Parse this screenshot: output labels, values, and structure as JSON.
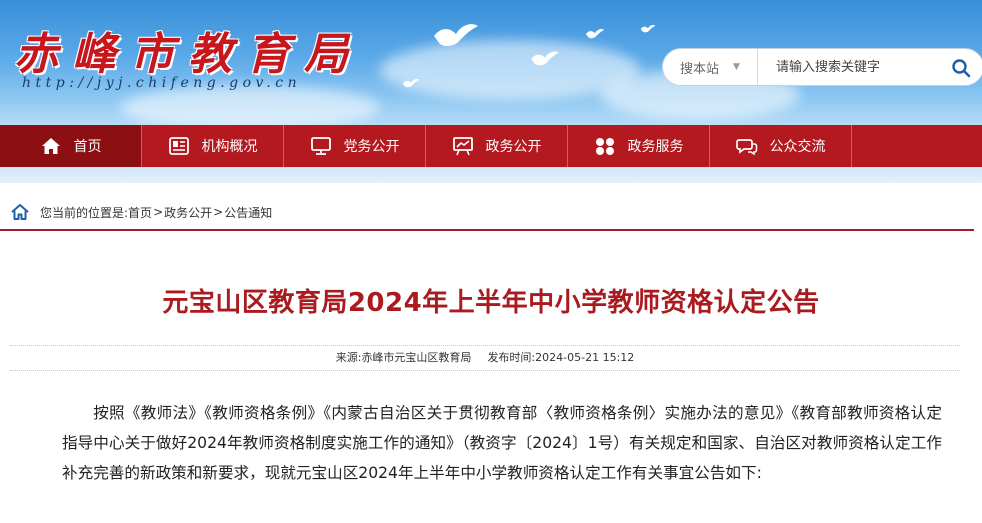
{
  "header": {
    "site_title": "赤峰市教育局",
    "site_url": "http://jyj.chifeng.gov.cn",
    "search": {
      "scope_label": "搜本站",
      "placeholder": "请输入搜索关键字"
    }
  },
  "nav": {
    "items": [
      {
        "label": "首页",
        "icon": "home-icon",
        "active": true
      },
      {
        "label": "机构概况",
        "icon": "info-card-icon",
        "active": false
      },
      {
        "label": "党务公开",
        "icon": "monitor-icon",
        "active": false
      },
      {
        "label": "政务公开",
        "icon": "presentation-board-icon",
        "active": false
      },
      {
        "label": "政务服务",
        "icon": "grid-dots-icon",
        "active": false
      },
      {
        "label": "公众交流",
        "icon": "chat-bubbles-icon",
        "active": false
      }
    ]
  },
  "breadcrumb": {
    "prefix": "您当前的位置是:",
    "items": [
      "首页",
      "政务公开",
      "公告通知"
    ],
    "separator": ">"
  },
  "article": {
    "title": "元宝山区教育局2024年上半年中小学教师资格认定公告",
    "source_label": "来源:",
    "source": "赤峰市元宝山区教育局",
    "date_label": "发布时间:",
    "date": "2024-05-21 15:12",
    "body": "按照《教师法》《教师资格条例》《内蒙古自治区关于贯彻教育部〈教师资格条例〉实施办法的意见》《教育部教师资格认定指导中心关于做好2024年教师资格制度实施工作的通知》（教资字〔2024〕1号）有关规定和国家、自治区对教师资格认定工作补充完善的新政策和新要求，现就元宝山区2024年上半年中小学教师资格认定工作有关事宜公告如下:"
  },
  "colors": {
    "brand_red": "#b3191e",
    "active_nav": "#8c0f13",
    "title_red": "#a91b1f",
    "sky_blue": "#5aa9e8"
  }
}
